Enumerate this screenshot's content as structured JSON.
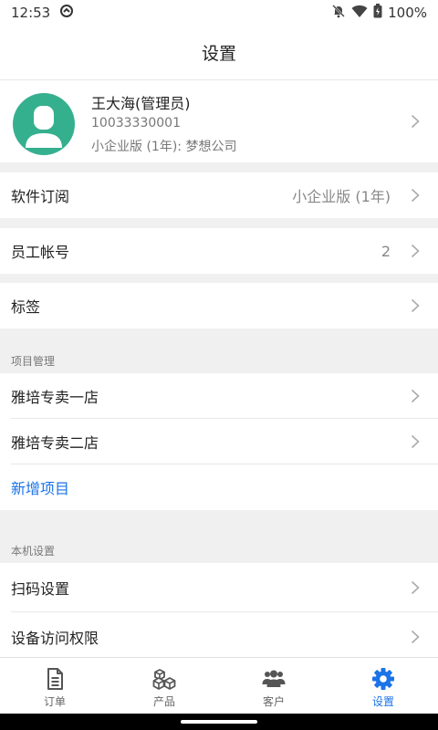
{
  "status": {
    "time": "12:53",
    "battery": "100%"
  },
  "header": {
    "title": "设置"
  },
  "profile": {
    "name": "王大海(管理员)",
    "id": "10033330001",
    "plan": "小企业版 (1年): 梦想公司"
  },
  "settings": {
    "subscription": {
      "label": "软件订阅",
      "value": "小企业版 (1年)"
    },
    "staff": {
      "label": "员工帐号",
      "value": "2"
    },
    "tags": {
      "label": "标签"
    }
  },
  "projects": {
    "section_label": "项目管理",
    "items": [
      {
        "label": "雅培专卖一店"
      },
      {
        "label": "雅培专卖二店"
      }
    ],
    "add_label": "新增项目"
  },
  "device": {
    "section_label": "本机设置",
    "items": [
      {
        "label": "扫码设置"
      },
      {
        "label": "设备访问权限"
      }
    ]
  },
  "tabs": [
    {
      "label": "订单",
      "icon": "document-icon"
    },
    {
      "label": "产品",
      "icon": "boxes-icon"
    },
    {
      "label": "客户",
      "icon": "users-icon"
    },
    {
      "label": "设置",
      "icon": "gear-icon"
    }
  ],
  "colors": {
    "accent": "#1a73e8",
    "avatar_bg": "#35b08f",
    "background": "#f0f0f0"
  }
}
